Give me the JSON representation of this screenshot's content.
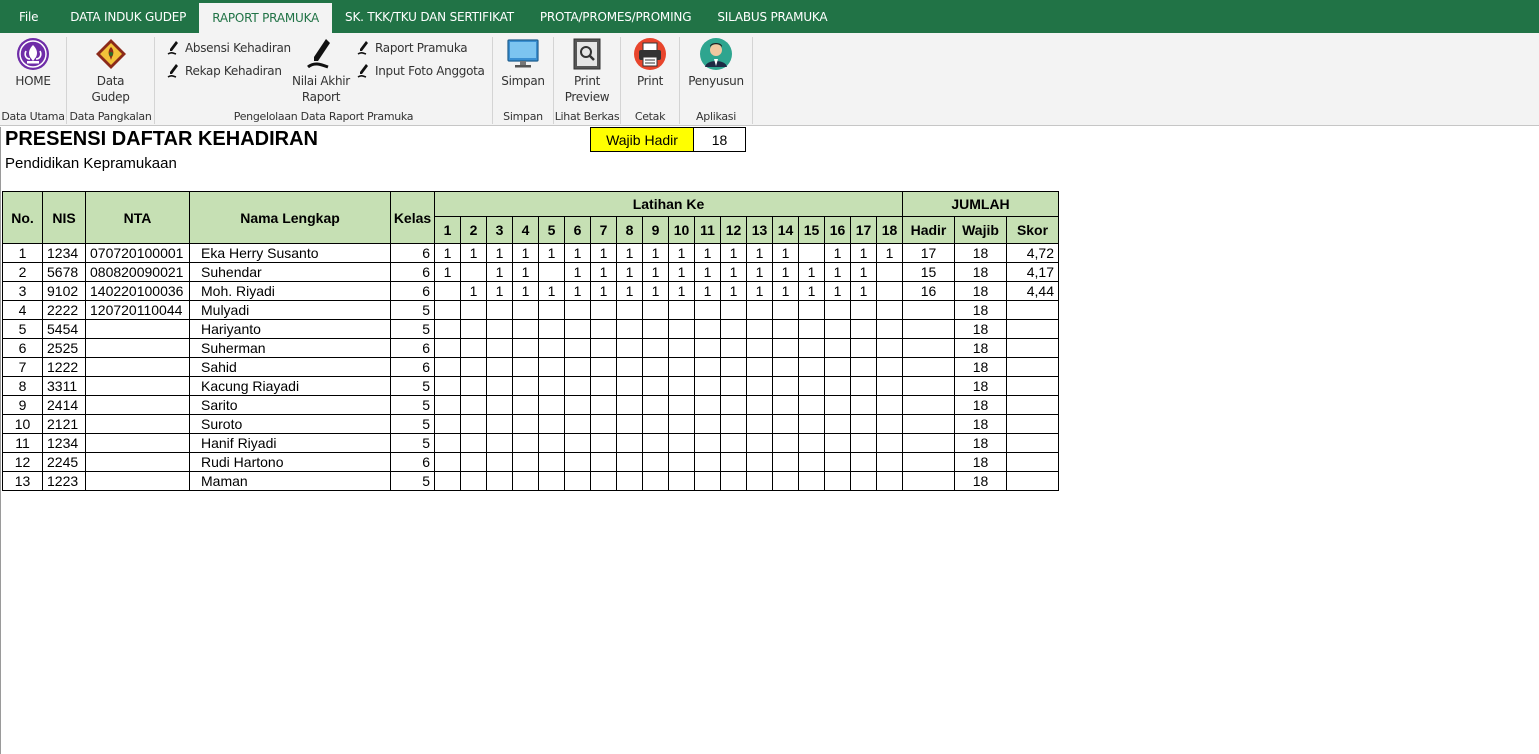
{
  "menu": {
    "tabs": [
      {
        "label": "File",
        "active": false
      },
      {
        "label": "DATA INDUK GUDEP",
        "active": false
      },
      {
        "label": "RAPORT PRAMUKA",
        "active": true
      },
      {
        "label": "SK. TKK/TKU DAN SERTIFIKAT",
        "active": false
      },
      {
        "label": "PROTA/PROMES/PROMING",
        "active": false
      },
      {
        "label": "SILABUS PRAMUKA",
        "active": false
      }
    ]
  },
  "ribbon": {
    "home_label": "HOME",
    "data_utama_label": "Data Utama",
    "data_gudep_label": "Data\nGudep",
    "data_pangkalan_label": "Data Pangkalan",
    "absensi_label": "Absensi Kehadiran",
    "rekap_label": "Rekap Kehadiran",
    "nilai_akhir_label": "Nilai Akhir\nRaport",
    "raport_pramuka_label": "Raport Pramuka",
    "input_foto_label": "Input Foto Anggota",
    "pengelolaan_label": "Pengelolaan Data Raport Pramuka",
    "simpan_btn_label": "Simpan",
    "simpan_group_label": "Simpan",
    "print_preview_label": "Print\nPreview",
    "lihat_berkas_label": "Lihat Berkas",
    "print_label": "Print",
    "cetak_label": "Cetak",
    "penyusun_label": "Penyusun",
    "aplikasi_label": "Aplikasi"
  },
  "sheet": {
    "title": "PRESENSI DAFTAR KEHADIRAN",
    "subtitle": "Pendidikan Kepramukaan",
    "wajib_hadir_label": "Wajib Hadir",
    "wajib_hadir_value": "18",
    "headers": {
      "no": "No.",
      "nis": "NIS",
      "nta": "NTA",
      "nama": "Nama Lengkap",
      "kelas": "Kelas",
      "latihan": "Latihan Ke",
      "jumlah": "JUMLAH",
      "hadir": "Hadir",
      "wajib": "Wajib",
      "skor": "Skor",
      "sessions": [
        "1",
        "2",
        "3",
        "4",
        "5",
        "6",
        "7",
        "8",
        "9",
        "10",
        "11",
        "12",
        "13",
        "14",
        "15",
        "16",
        "17",
        "18"
      ]
    },
    "rows": [
      {
        "no": "1",
        "nis": "1234",
        "nta": "070720100001",
        "nama": "Eka Herry Susanto",
        "kelas": "6",
        "att": [
          "1",
          "1",
          "1",
          "1",
          "1",
          "1",
          "1",
          "1",
          "1",
          "1",
          "1",
          "1",
          "1",
          "1",
          "",
          "1",
          "1",
          "1"
        ],
        "hadir": "17",
        "wajib": "18",
        "skor": "4,72"
      },
      {
        "no": "2",
        "nis": "5678",
        "nta": "080820090021",
        "nama": "Suhendar",
        "kelas": "6",
        "att": [
          "1",
          "",
          "1",
          "1",
          "",
          "1",
          "1",
          "1",
          "1",
          "1",
          "1",
          "1",
          "1",
          "1",
          "1",
          "1",
          "1",
          ""
        ],
        "hadir": "15",
        "wajib": "18",
        "skor": "4,17"
      },
      {
        "no": "3",
        "nis": "9102",
        "nta": "140220100036",
        "nama": "Moh. Riyadi",
        "kelas": "6",
        "att": [
          "",
          "1",
          "1",
          "1",
          "1",
          "1",
          "1",
          "1",
          "1",
          "1",
          "1",
          "1",
          "1",
          "1",
          "1",
          "1",
          "1",
          ""
        ],
        "hadir": "16",
        "wajib": "18",
        "skor": "4,44"
      },
      {
        "no": "4",
        "nis": "2222",
        "nta": "120720110044",
        "nama": "Mulyadi",
        "kelas": "5",
        "att": [
          "",
          "",
          "",
          "",
          "",
          "",
          "",
          "",
          "",
          "",
          "",
          "",
          "",
          "",
          "",
          "",
          "",
          ""
        ],
        "hadir": "",
        "wajib": "18",
        "skor": ""
      },
      {
        "no": "5",
        "nis": "5454",
        "nta": "",
        "nama": "Hariyanto",
        "kelas": "5",
        "att": [
          "",
          "",
          "",
          "",
          "",
          "",
          "",
          "",
          "",
          "",
          "",
          "",
          "",
          "",
          "",
          "",
          "",
          ""
        ],
        "hadir": "",
        "wajib": "18",
        "skor": ""
      },
      {
        "no": "6",
        "nis": "2525",
        "nta": "",
        "nama": "Suherman",
        "kelas": "6",
        "att": [
          "",
          "",
          "",
          "",
          "",
          "",
          "",
          "",
          "",
          "",
          "",
          "",
          "",
          "",
          "",
          "",
          "",
          ""
        ],
        "hadir": "",
        "wajib": "18",
        "skor": ""
      },
      {
        "no": "7",
        "nis": "1222",
        "nta": "",
        "nama": "Sahid",
        "kelas": "6",
        "att": [
          "",
          "",
          "",
          "",
          "",
          "",
          "",
          "",
          "",
          "",
          "",
          "",
          "",
          "",
          "",
          "",
          "",
          ""
        ],
        "hadir": "",
        "wajib": "18",
        "skor": ""
      },
      {
        "no": "8",
        "nis": "3311",
        "nta": "",
        "nama": "Kacung Riayadi",
        "kelas": "5",
        "att": [
          "",
          "",
          "",
          "",
          "",
          "",
          "",
          "",
          "",
          "",
          "",
          "",
          "",
          "",
          "",
          "",
          "",
          ""
        ],
        "hadir": "",
        "wajib": "18",
        "skor": ""
      },
      {
        "no": "9",
        "nis": "2414",
        "nta": "",
        "nama": "Sarito",
        "kelas": "5",
        "att": [
          "",
          "",
          "",
          "",
          "",
          "",
          "",
          "",
          "",
          "",
          "",
          "",
          "",
          "",
          "",
          "",
          "",
          ""
        ],
        "hadir": "",
        "wajib": "18",
        "skor": ""
      },
      {
        "no": "10",
        "nis": "2121",
        "nta": "",
        "nama": "Suroto",
        "kelas": "5",
        "att": [
          "",
          "",
          "",
          "",
          "",
          "",
          "",
          "",
          "",
          "",
          "",
          "",
          "",
          "",
          "",
          "",
          "",
          ""
        ],
        "hadir": "",
        "wajib": "18",
        "skor": ""
      },
      {
        "no": "11",
        "nis": "1234",
        "nta": "",
        "nama": "Hanif Riyadi",
        "kelas": "5",
        "att": [
          "",
          "",
          "",
          "",
          "",
          "",
          "",
          "",
          "",
          "",
          "",
          "",
          "",
          "",
          "",
          "",
          "",
          ""
        ],
        "hadir": "",
        "wajib": "18",
        "skor": ""
      },
      {
        "no": "12",
        "nis": "2245",
        "nta": "",
        "nama": "Rudi Hartono",
        "kelas": "6",
        "att": [
          "",
          "",
          "",
          "",
          "",
          "",
          "",
          "",
          "",
          "",
          "",
          "",
          "",
          "",
          "",
          "",
          "",
          ""
        ],
        "hadir": "",
        "wajib": "18",
        "skor": ""
      },
      {
        "no": "13",
        "nis": "1223",
        "nta": "",
        "nama": "Maman",
        "kelas": "5",
        "att": [
          "",
          "",
          "",
          "",
          "",
          "",
          "",
          "",
          "",
          "",
          "",
          "",
          "",
          "",
          "",
          "",
          "",
          ""
        ],
        "hadir": "",
        "wajib": "18",
        "skor": ""
      }
    ]
  },
  "colors": {
    "menubar": "#217346",
    "header_fill": "#c6e0b4",
    "wajib_fill": "#ffff00"
  }
}
